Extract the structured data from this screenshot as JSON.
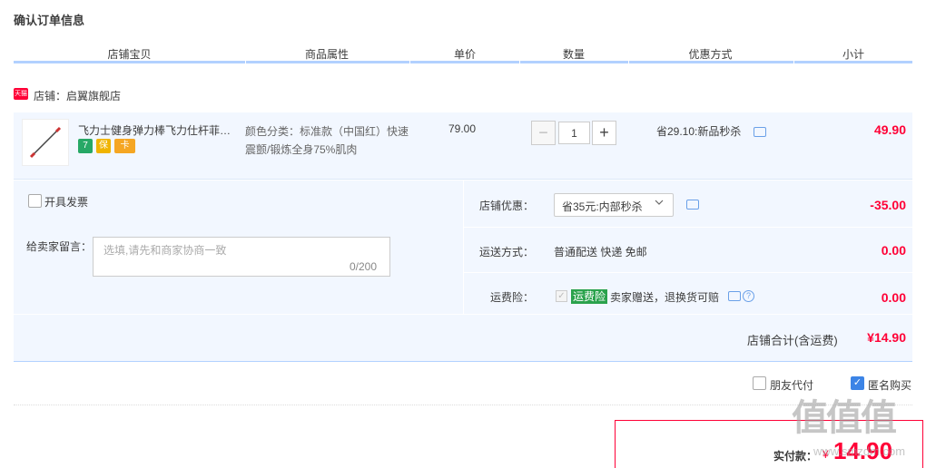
{
  "page": {
    "title": "确认订单信息"
  },
  "columns": [
    "店铺宝贝",
    "商品属性",
    "单价",
    "数量",
    "优惠方式",
    "小计"
  ],
  "shop": {
    "badge": "天猫",
    "label": "店铺：启翼旗舰店"
  },
  "item": {
    "title": "飞力士健身弹力棒飞力仕杆菲力士棒...",
    "services": [
      "7",
      "保",
      "卡"
    ],
    "attributes": "颜色分类：标准款（中国红）快速震颤/锻炼全身75%肌肉",
    "price": "79.00",
    "quantity": "1",
    "minus": "−",
    "plus": "+",
    "promo": "省29.10:新品秒杀",
    "subtotal": "49.90"
  },
  "invoice": {
    "label": "开具发票"
  },
  "message": {
    "label": "给卖家留言：",
    "placeholder": "选填,请先和商家协商一致",
    "counter": "0/200"
  },
  "shop_discount": {
    "label": "店铺优惠：",
    "selected": "省35元:内部秒杀",
    "amount": "-35.00"
  },
  "shipping": {
    "label": "运送方式：",
    "value": "普通配送 快递 免邮",
    "amount": "0.00"
  },
  "insurance": {
    "label": "运费险：",
    "badge": "运费险",
    "text": "卖家赠送，退换货可赔",
    "amount": "0.00"
  },
  "shop_total": {
    "label": "店铺合计(含运费)",
    "amount": "¥14.90"
  },
  "options": {
    "friend_pay": "朋友代付",
    "anonymous": "匿名购买"
  },
  "payment": {
    "label": "实付款：",
    "currency": "¥",
    "amount": "14.90"
  },
  "watermark": {
    "text": "值值值",
    "sub": "www.smzdm.com"
  },
  "colors": {
    "accent_red": "#ff0036",
    "header_blue": "#b2d1ff",
    "panel_bg": "#f2f7ff",
    "insurance_green": "#2aa24c"
  }
}
